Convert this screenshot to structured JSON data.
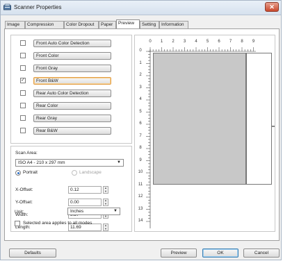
{
  "window": {
    "title": "Scanner Properties"
  },
  "tabs": [
    {
      "label": "Image"
    },
    {
      "label": "Compression"
    },
    {
      "label": "Color Dropout"
    },
    {
      "label": "Paper"
    },
    {
      "label": "Preview"
    },
    {
      "label": "Setting"
    },
    {
      "label": "Information"
    }
  ],
  "active_tab": "Preview",
  "modes": [
    {
      "label": "Front Auto Color Detection",
      "checked": false
    },
    {
      "label": "Front Color",
      "checked": false
    },
    {
      "label": "Front Gray",
      "checked": false
    },
    {
      "label": "Front B&W",
      "checked": true
    },
    {
      "label": "Rear Auto Color Detection",
      "checked": false
    },
    {
      "label": "Rear Color",
      "checked": false
    },
    {
      "label": "Rear Gray",
      "checked": false
    },
    {
      "label": "Rear B&W",
      "checked": false
    }
  ],
  "scan_area": {
    "label": "Scan Area:",
    "value": "ISO A4 - 210 x 297 mm",
    "portrait_label": "Portrait",
    "landscape_label": "Landscape"
  },
  "offsets": {
    "x_label": "X-Offset:",
    "x_value": "0.12",
    "y_label": "Y-Offset:",
    "y_value": "0.00",
    "width_label": "Width:",
    "width_value": "8.27",
    "length_label": "Length:",
    "length_value": "11.69"
  },
  "unit": {
    "label": "Unit:",
    "value": "Inches"
  },
  "applies_all": {
    "label": "Selected area applies to all modes",
    "checked": false
  },
  "ruler": {
    "top": [
      "0",
      "1",
      "2",
      "3",
      "4",
      "5",
      "6",
      "7",
      "8",
      "9"
    ],
    "left": [
      "0",
      "1",
      "2",
      "3",
      "4",
      "5",
      "6",
      "7",
      "8",
      "9",
      "10",
      "11",
      "12",
      "13",
      "14"
    ]
  },
  "buttons": {
    "defaults": "Defaults",
    "preview": "Preview",
    "ok": "OK",
    "cancel": "Cancel"
  },
  "colors": {
    "title_bar": "#dce6f1",
    "close_button": "#c9482d",
    "page_gray": "#c8c8c8",
    "selected_outline": "#e3a04a"
  },
  "icons": {
    "app": "scanner-icon",
    "close": "close-icon",
    "dropdown": "chevron-down-icon",
    "spinner": "spinner-arrows-icon"
  }
}
